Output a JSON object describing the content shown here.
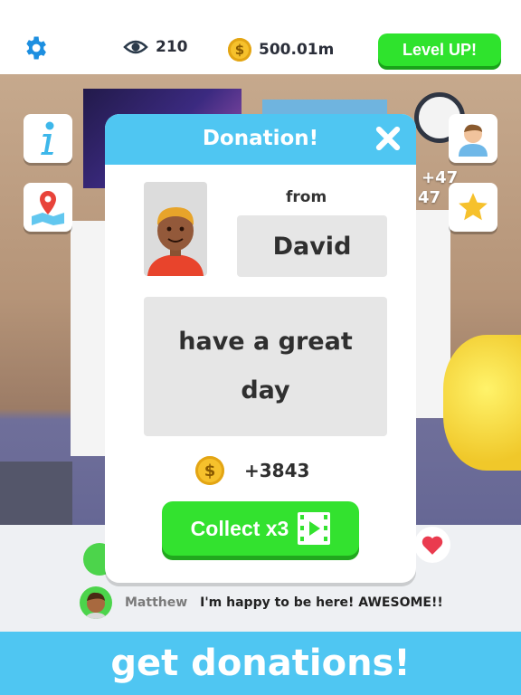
{
  "top_bar": {
    "views": "210",
    "coins": "500.01m",
    "coin_symbol": "$",
    "level_up_label": "Level UP!"
  },
  "scene": {
    "floating_1": "+47",
    "floating_2": "47"
  },
  "dialog": {
    "title": "Donation!",
    "from_label": "from",
    "donor_name": "David",
    "message": "have a great day",
    "reward": "+3843",
    "coin_symbol": "$",
    "collect_label": "Collect x3"
  },
  "chat": {
    "messages": [
      {
        "user": "Matthew",
        "text": "I'm happy to be here! AWESOME!!"
      }
    ]
  },
  "banner": {
    "text": "get donations!"
  },
  "colors": {
    "accent_blue": "#4fc6f2",
    "green_button": "#33e22f",
    "coin_gold": "#f6c12c"
  },
  "icons": [
    "gear-icon",
    "eye-icon",
    "coin-icon",
    "info-icon",
    "map-pin-icon",
    "profile-icon",
    "star-icon",
    "close-icon",
    "video-icon",
    "heart-icon"
  ]
}
